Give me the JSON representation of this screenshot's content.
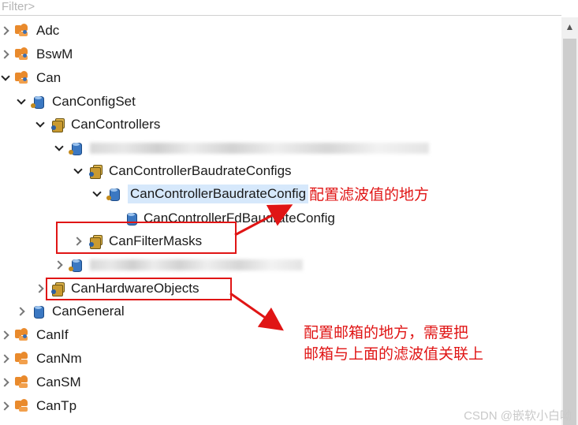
{
  "filter": {
    "placeholder": "Filter>"
  },
  "tree": {
    "adc": "Adc",
    "bswm": "BswM",
    "can": "Can",
    "can_config_set": "CanConfigSet",
    "can_controllers": "CanControllers",
    "can_controller_baudrate_configs": "CanControllerBaudrateConfigs",
    "can_controller_baudrate_config": "CanControllerBaudrateConfig",
    "can_controller_fd_baudrate_config": "CanControllerFdBaudrateConfig",
    "can_filter_masks": "CanFilterMasks",
    "can_hardware_objects": "CanHardwareObjects",
    "can_general": "CanGeneral",
    "canif": "CanIf",
    "cannm": "CanNm",
    "cansm": "CanSM",
    "cantp": "CanTp"
  },
  "annotations": {
    "filter_note": "配置滤波值的地方",
    "mailbox_note_line1": "配置邮箱的地方，需要把",
    "mailbox_note_line2": "邮箱与上面的滤波值关联上"
  },
  "watermark": "CSDN @嵌软小白呦",
  "colors": {
    "annotation_red": "#e01515",
    "selection": "#d6e8fb"
  }
}
